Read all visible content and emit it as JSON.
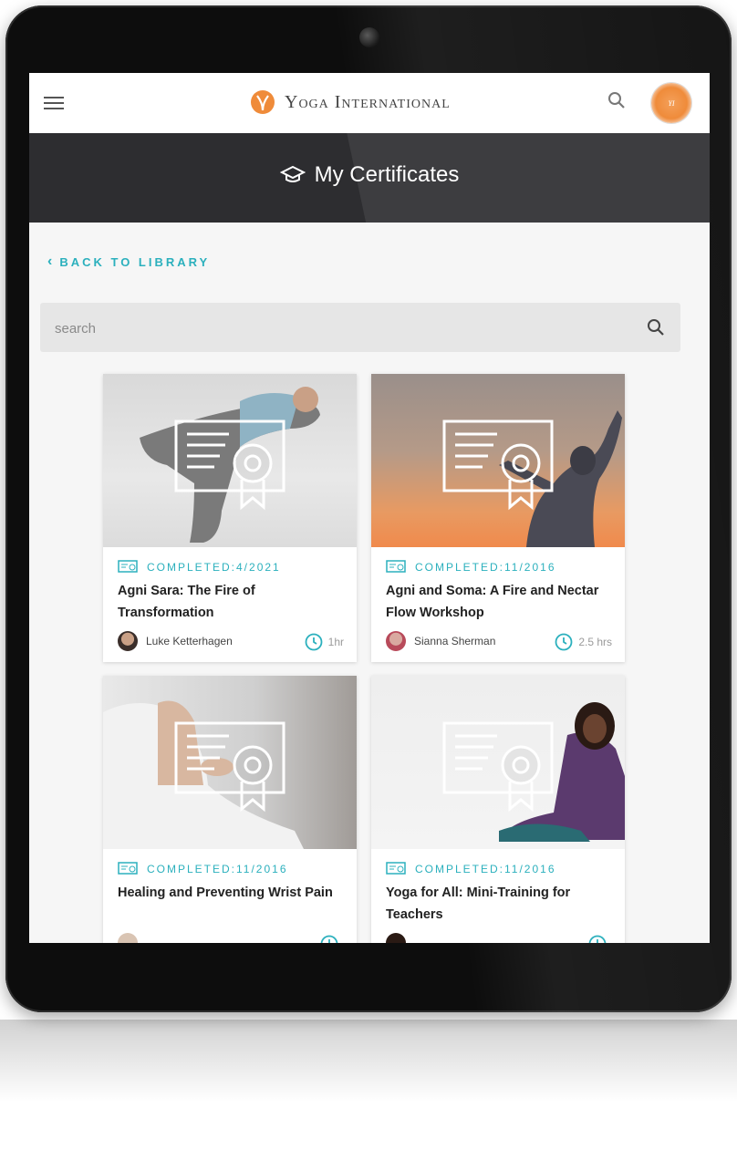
{
  "app": {
    "brand": "Yoga International",
    "avatar_text": "YI"
  },
  "header": {
    "title": "My Certificates"
  },
  "nav": {
    "back_label": "BACK TO LIBRARY"
  },
  "search": {
    "placeholder": "search"
  },
  "colors": {
    "accent": "#2bb0bd",
    "brand_orange": "#ef8b3a",
    "hero_bg": "#2d2d30"
  },
  "certificates": [
    {
      "completed": "COMPLETED:4/2021",
      "title": "Agni Sara: The Fire of Transformation",
      "author": "Luke Ketterhagen",
      "duration": "1hr"
    },
    {
      "completed": "COMPLETED:11/2016",
      "title": "Agni and Soma: A Fire and Nectar Flow Workshop",
      "author": "Sianna Sherman",
      "duration": "2.5 hrs"
    },
    {
      "completed": "COMPLETED:11/2016",
      "title": "Healing and Preventing Wrist Pain",
      "author": "",
      "duration": ""
    },
    {
      "completed": "COMPLETED:11/2016",
      "title": "Yoga for All: Mini-Training for Teachers",
      "author": "",
      "duration": ""
    }
  ],
  "icons": {
    "menu": "hamburger-icon",
    "search": "search-icon",
    "graduation": "graduation-cap-icon",
    "certificate": "certificate-icon",
    "clock": "clock-icon",
    "back": "chevron-left-icon"
  }
}
